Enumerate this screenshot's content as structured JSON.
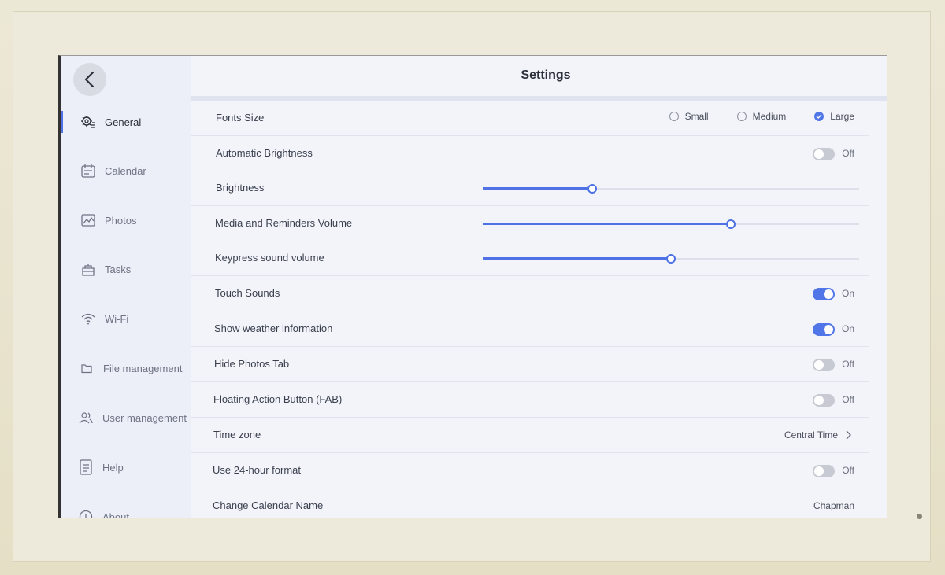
{
  "header": {
    "title": "Settings"
  },
  "sidebar": {
    "items": [
      {
        "label": "General",
        "icon": "gear-list-icon",
        "active": true
      },
      {
        "label": "Calendar",
        "icon": "calendar-icon",
        "active": false
      },
      {
        "label": "Photos",
        "icon": "photo-icon",
        "active": false
      },
      {
        "label": "Tasks",
        "icon": "tasks-icon",
        "active": false
      },
      {
        "label": "Wi-Fi",
        "icon": "wifi-icon",
        "active": false
      },
      {
        "label": "File management",
        "icon": "folder-icon",
        "active": false
      },
      {
        "label": "User management",
        "icon": "users-icon",
        "active": false
      },
      {
        "label": "Help",
        "icon": "help-doc-icon",
        "active": false
      },
      {
        "label": "About",
        "icon": "info-icon",
        "active": false
      }
    ]
  },
  "settings": {
    "fonts_size": {
      "label": "Fonts Size",
      "options": [
        "Small",
        "Medium",
        "Large"
      ],
      "selected": "Large"
    },
    "auto_brightness": {
      "label": "Automatic Brightness",
      "state": "Off"
    },
    "brightness": {
      "label": "Brightness",
      "value": 0.29
    },
    "media_volume": {
      "label": "Media and Reminders Volume",
      "value": 0.66
    },
    "keypress_volume": {
      "label": "Keypress sound volume",
      "value": 0.5
    },
    "touch_sounds": {
      "label": "Touch Sounds",
      "state": "On"
    },
    "weather_info": {
      "label": "Show weather information",
      "state": "On"
    },
    "hide_photos": {
      "label": "Hide Photos Tab",
      "state": "Off"
    },
    "fab": {
      "label": "Floating Action Button (FAB)",
      "state": "Off"
    },
    "time_zone": {
      "label": "Time zone",
      "value": "Central Time"
    },
    "hour_format": {
      "label": "Use 24-hour format",
      "state": "Off"
    },
    "calendar_name": {
      "label": "Change Calendar Name",
      "value": "Chapman"
    }
  },
  "colors": {
    "accent": "#4e72e6",
    "toggle_off": "#c7cad3",
    "sidebar_bg": "#eceef8",
    "main_bg": "#f2f4fa"
  }
}
